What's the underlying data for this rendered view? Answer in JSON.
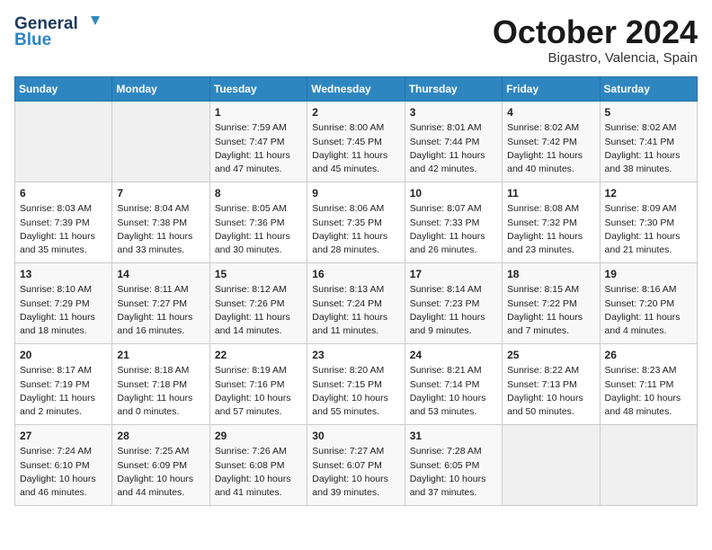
{
  "header": {
    "logo_line1": "General",
    "logo_line2": "Blue",
    "month": "October 2024",
    "location": "Bigastro, Valencia, Spain"
  },
  "weekdays": [
    "Sunday",
    "Monday",
    "Tuesday",
    "Wednesday",
    "Thursday",
    "Friday",
    "Saturday"
  ],
  "weeks": [
    [
      {
        "day": "",
        "info": ""
      },
      {
        "day": "",
        "info": ""
      },
      {
        "day": "1",
        "info": "Sunrise: 7:59 AM\nSunset: 7:47 PM\nDaylight: 11 hours\nand 47 minutes."
      },
      {
        "day": "2",
        "info": "Sunrise: 8:00 AM\nSunset: 7:45 PM\nDaylight: 11 hours\nand 45 minutes."
      },
      {
        "day": "3",
        "info": "Sunrise: 8:01 AM\nSunset: 7:44 PM\nDaylight: 11 hours\nand 42 minutes."
      },
      {
        "day": "4",
        "info": "Sunrise: 8:02 AM\nSunset: 7:42 PM\nDaylight: 11 hours\nand 40 minutes."
      },
      {
        "day": "5",
        "info": "Sunrise: 8:02 AM\nSunset: 7:41 PM\nDaylight: 11 hours\nand 38 minutes."
      }
    ],
    [
      {
        "day": "6",
        "info": "Sunrise: 8:03 AM\nSunset: 7:39 PM\nDaylight: 11 hours\nand 35 minutes."
      },
      {
        "day": "7",
        "info": "Sunrise: 8:04 AM\nSunset: 7:38 PM\nDaylight: 11 hours\nand 33 minutes."
      },
      {
        "day": "8",
        "info": "Sunrise: 8:05 AM\nSunset: 7:36 PM\nDaylight: 11 hours\nand 30 minutes."
      },
      {
        "day": "9",
        "info": "Sunrise: 8:06 AM\nSunset: 7:35 PM\nDaylight: 11 hours\nand 28 minutes."
      },
      {
        "day": "10",
        "info": "Sunrise: 8:07 AM\nSunset: 7:33 PM\nDaylight: 11 hours\nand 26 minutes."
      },
      {
        "day": "11",
        "info": "Sunrise: 8:08 AM\nSunset: 7:32 PM\nDaylight: 11 hours\nand 23 minutes."
      },
      {
        "day": "12",
        "info": "Sunrise: 8:09 AM\nSunset: 7:30 PM\nDaylight: 11 hours\nand 21 minutes."
      }
    ],
    [
      {
        "day": "13",
        "info": "Sunrise: 8:10 AM\nSunset: 7:29 PM\nDaylight: 11 hours\nand 18 minutes."
      },
      {
        "day": "14",
        "info": "Sunrise: 8:11 AM\nSunset: 7:27 PM\nDaylight: 11 hours\nand 16 minutes."
      },
      {
        "day": "15",
        "info": "Sunrise: 8:12 AM\nSunset: 7:26 PM\nDaylight: 11 hours\nand 14 minutes."
      },
      {
        "day": "16",
        "info": "Sunrise: 8:13 AM\nSunset: 7:24 PM\nDaylight: 11 hours\nand 11 minutes."
      },
      {
        "day": "17",
        "info": "Sunrise: 8:14 AM\nSunset: 7:23 PM\nDaylight: 11 hours\nand 9 minutes."
      },
      {
        "day": "18",
        "info": "Sunrise: 8:15 AM\nSunset: 7:22 PM\nDaylight: 11 hours\nand 7 minutes."
      },
      {
        "day": "19",
        "info": "Sunrise: 8:16 AM\nSunset: 7:20 PM\nDaylight: 11 hours\nand 4 minutes."
      }
    ],
    [
      {
        "day": "20",
        "info": "Sunrise: 8:17 AM\nSunset: 7:19 PM\nDaylight: 11 hours\nand 2 minutes."
      },
      {
        "day": "21",
        "info": "Sunrise: 8:18 AM\nSunset: 7:18 PM\nDaylight: 11 hours\nand 0 minutes."
      },
      {
        "day": "22",
        "info": "Sunrise: 8:19 AM\nSunset: 7:16 PM\nDaylight: 10 hours\nand 57 minutes."
      },
      {
        "day": "23",
        "info": "Sunrise: 8:20 AM\nSunset: 7:15 PM\nDaylight: 10 hours\nand 55 minutes."
      },
      {
        "day": "24",
        "info": "Sunrise: 8:21 AM\nSunset: 7:14 PM\nDaylight: 10 hours\nand 53 minutes."
      },
      {
        "day": "25",
        "info": "Sunrise: 8:22 AM\nSunset: 7:13 PM\nDaylight: 10 hours\nand 50 minutes."
      },
      {
        "day": "26",
        "info": "Sunrise: 8:23 AM\nSunset: 7:11 PM\nDaylight: 10 hours\nand 48 minutes."
      }
    ],
    [
      {
        "day": "27",
        "info": "Sunrise: 7:24 AM\nSunset: 6:10 PM\nDaylight: 10 hours\nand 46 minutes."
      },
      {
        "day": "28",
        "info": "Sunrise: 7:25 AM\nSunset: 6:09 PM\nDaylight: 10 hours\nand 44 minutes."
      },
      {
        "day": "29",
        "info": "Sunrise: 7:26 AM\nSunset: 6:08 PM\nDaylight: 10 hours\nand 41 minutes."
      },
      {
        "day": "30",
        "info": "Sunrise: 7:27 AM\nSunset: 6:07 PM\nDaylight: 10 hours\nand 39 minutes."
      },
      {
        "day": "31",
        "info": "Sunrise: 7:28 AM\nSunset: 6:05 PM\nDaylight: 10 hours\nand 37 minutes."
      },
      {
        "day": "",
        "info": ""
      },
      {
        "day": "",
        "info": ""
      }
    ]
  ]
}
